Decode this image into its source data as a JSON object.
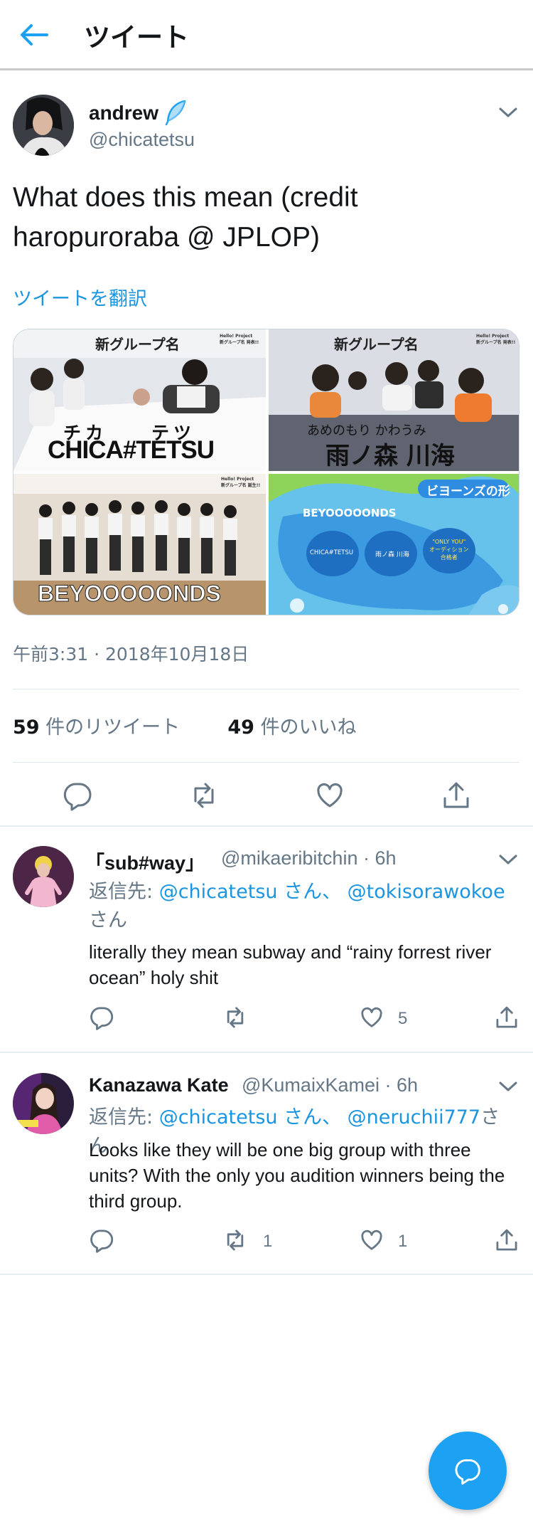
{
  "header": {
    "title": "ツイート",
    "back_icon": "arrow-left-icon"
  },
  "tweet": {
    "author_name": "andrew",
    "author_handle": "@chicatetsu",
    "text": "What does this mean (credit haropuroraba @ JPLOP)",
    "translate_label": "ツイートを翻訳",
    "media": {
      "panels": [
        {
          "top_label": "新グループ名",
          "corner_label": "Hello! Project\n新グループ名 発表!!",
          "kana": "チカ　　テツ",
          "title": "CHICA#TETSU"
        },
        {
          "top_label": "新グループ名",
          "corner_label": "Hello! Project\n新グループ名 発表!!",
          "kana": "あめのもり かわうみ",
          "title": "雨ノ森 川海"
        },
        {
          "corner_label": "Hello! Project\n新グループ名 誕生!!",
          "title": "BEYOOOOONDS"
        },
        {
          "tag": "ビヨーンズの形",
          "title": "BEYOOOOONDS",
          "bubbles": [
            "CHICA#TETSU",
            "雨ノ森 川海",
            "\"ONLY YOU\"\nオーディション\n合格者"
          ]
        }
      ]
    },
    "timestamp": "午前3:31 · 2018年10月18日",
    "retweets_count": "59",
    "retweets_label": "件のリツイート",
    "likes_count": "49",
    "likes_label": "件のいいね"
  },
  "replies": [
    {
      "name": "「sub#way」",
      "handle": "@mikaeribitchin · 6h",
      "replying_prefix": "返信先: ",
      "mention1": "@chicatetsu",
      "mention1_suffix": " さん、 ",
      "mention2": "@tokisorawokoe",
      "mention2_suffix": "さん",
      "text": "literally they mean subway and “rainy forrest river ocean” holy shit",
      "retweets": "",
      "likes": "5"
    },
    {
      "name": "Kanazawa Kate",
      "handle": "@KumaixKamei · 6h",
      "replying_prefix": "返信先: ",
      "mention1": "@chicatetsu",
      "mention1_suffix": " さん、 ",
      "mention2": "@neruchii777",
      "mention2_suffix": "さん",
      "text": "Looks like they will be one big group with three units? With the only you audition winners being the third group.",
      "retweets": "1",
      "likes": "1"
    }
  ],
  "colors": {
    "accent": "#1da1f2",
    "link": "#1b95e0",
    "muted": "#657786"
  },
  "icons": [
    "arrow-left-icon",
    "feather-badge-icon",
    "chevron-down-icon",
    "reply-icon",
    "retweet-icon",
    "like-icon",
    "share-icon",
    "compose-reply-icon"
  ]
}
